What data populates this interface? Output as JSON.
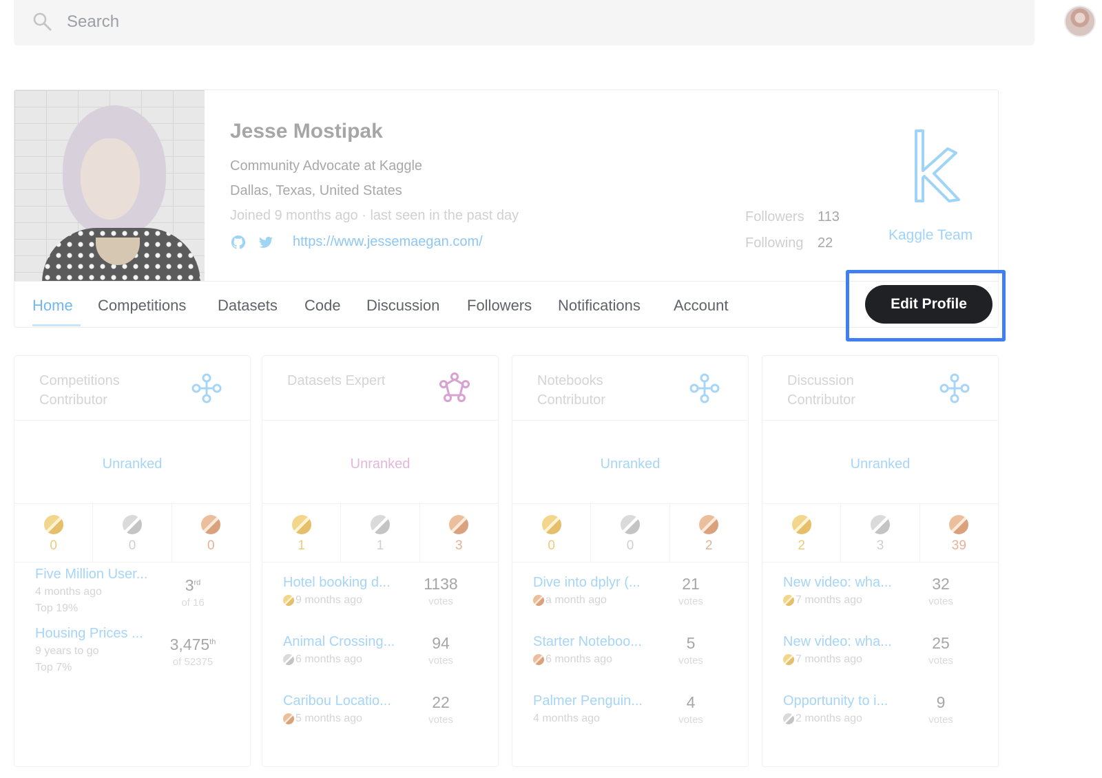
{
  "search": {
    "placeholder": "Search"
  },
  "profile": {
    "name": "Jesse Mostipak",
    "title": "Community Advocate at Kaggle",
    "location": "Dallas, Texas, United States",
    "joined": "Joined 9 months ago · last seen in the past day",
    "website": "https://www.jessemaegan.com/",
    "followers_label": "Followers",
    "followers_count": "113",
    "following_label": "Following",
    "following_count": "22",
    "team_label": "Kaggle Team"
  },
  "tabs": [
    {
      "label": "Home"
    },
    {
      "label": "Competitions"
    },
    {
      "label": "Datasets"
    },
    {
      "label": "Code"
    },
    {
      "label": "Discussion"
    },
    {
      "label": "Followers"
    },
    {
      "label": "Notifications"
    },
    {
      "label": "Account"
    }
  ],
  "edit_profile_label": "Edit Profile",
  "colors": {
    "accent_blue": "#70b8ee",
    "datasets_pink": "#d9a0d2",
    "highlight_blue": "#3f7ff0",
    "button_dark": "#202124"
  },
  "tiers": [
    {
      "title": "Competitions Contributor",
      "icon": "contributor-tier-icon",
      "rank": "Unranked",
      "medals": {
        "gold": "0",
        "silver": "0",
        "bronze": "0"
      },
      "entries": [
        {
          "title": "Five Million User...",
          "sub": "4 months ago",
          "sub2": "Top 19%",
          "num": "3",
          "sup": "rd",
          "unit": "of 16"
        },
        {
          "title": "Housing Prices ...",
          "sub": "9 years to go",
          "sub2": "Top 7%",
          "num": "3,475",
          "sup": "th",
          "unit": "of 52375"
        }
      ]
    },
    {
      "title": "Datasets Expert",
      "icon": "expert-tier-icon",
      "rank": "Unranked",
      "medals": {
        "gold": "1",
        "silver": "1",
        "bronze": "3"
      },
      "entries": [
        {
          "title": "Hotel booking d...",
          "sub": "9 months ago",
          "medal": "gold",
          "num": "1138",
          "unit": "votes"
        },
        {
          "title": "Animal Crossing...",
          "sub": "6 months ago",
          "medal": "silver",
          "num": "94",
          "unit": "votes"
        },
        {
          "title": "Caribou Locatio...",
          "sub": "5 months ago",
          "medal": "bronze",
          "num": "22",
          "unit": "votes"
        }
      ]
    },
    {
      "title": "Notebooks Contributor",
      "icon": "contributor-tier-icon",
      "rank": "Unranked",
      "medals": {
        "gold": "0",
        "silver": "0",
        "bronze": "2"
      },
      "entries": [
        {
          "title": "Dive into dplyr (...",
          "sub": "a month ago",
          "medal": "bronze",
          "num": "21",
          "unit": "votes"
        },
        {
          "title": "Starter Noteboo...",
          "sub": "6 months ago",
          "medal": "bronze",
          "num": "5",
          "unit": "votes"
        },
        {
          "title": "Palmer Penguin...",
          "sub": "4 months ago",
          "num": "4",
          "unit": "votes"
        }
      ]
    },
    {
      "title": "Discussion Contributor",
      "icon": "contributor-tier-icon",
      "rank": "Unranked",
      "medals": {
        "gold": "2",
        "silver": "3",
        "bronze": "39"
      },
      "entries": [
        {
          "title": "New video: wha...",
          "sub": "7 months ago",
          "medal": "gold",
          "num": "32",
          "unit": "votes"
        },
        {
          "title": "New video: wha...",
          "sub": "7 months ago",
          "medal": "gold",
          "num": "25",
          "unit": "votes"
        },
        {
          "title": "Opportunity to i...",
          "sub": "2 months ago",
          "medal": "silver",
          "num": "9",
          "unit": "votes"
        }
      ]
    }
  ]
}
